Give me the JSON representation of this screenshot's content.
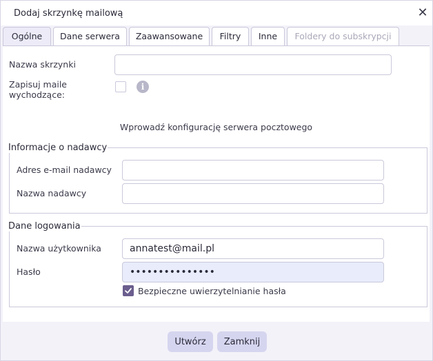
{
  "dialog": {
    "title": "Dodaj skrzynkę mailową"
  },
  "tabs": [
    {
      "label": "Ogólne",
      "active": true
    },
    {
      "label": "Dane serwera"
    },
    {
      "label": "Zaawansowane"
    },
    {
      "label": "Filtry"
    },
    {
      "label": "Inne"
    },
    {
      "label": "Foldery do subskrypcji",
      "disabled": true
    }
  ],
  "general": {
    "mailbox_name_label": "Nazwa skrzynki",
    "mailbox_name_value": "",
    "save_outgoing_label_line1": "Zapisuj maile",
    "save_outgoing_label_line2": "wychodzące:",
    "info_glyph": "i",
    "hint": "Wprowadź konfigurację serwera pocztowego"
  },
  "sender": {
    "legend": "Informacje o nadawcy",
    "email_label": "Adres e-mail nadawcy",
    "email_value": "",
    "name_label": "Nazwa nadawcy",
    "name_value": ""
  },
  "login": {
    "legend": "Dane logowania",
    "username_label": "Nazwa użytkownika",
    "username_value": "annatest@mail.pl",
    "password_label": "Hasło",
    "password_value": "secretpass12345",
    "secure_auth_label": "Bezpieczne uwierzytelnianie hasła",
    "secure_auth_checked": true
  },
  "footer": {
    "create_label": "Utwórz",
    "close_label": "Zamknij"
  }
}
